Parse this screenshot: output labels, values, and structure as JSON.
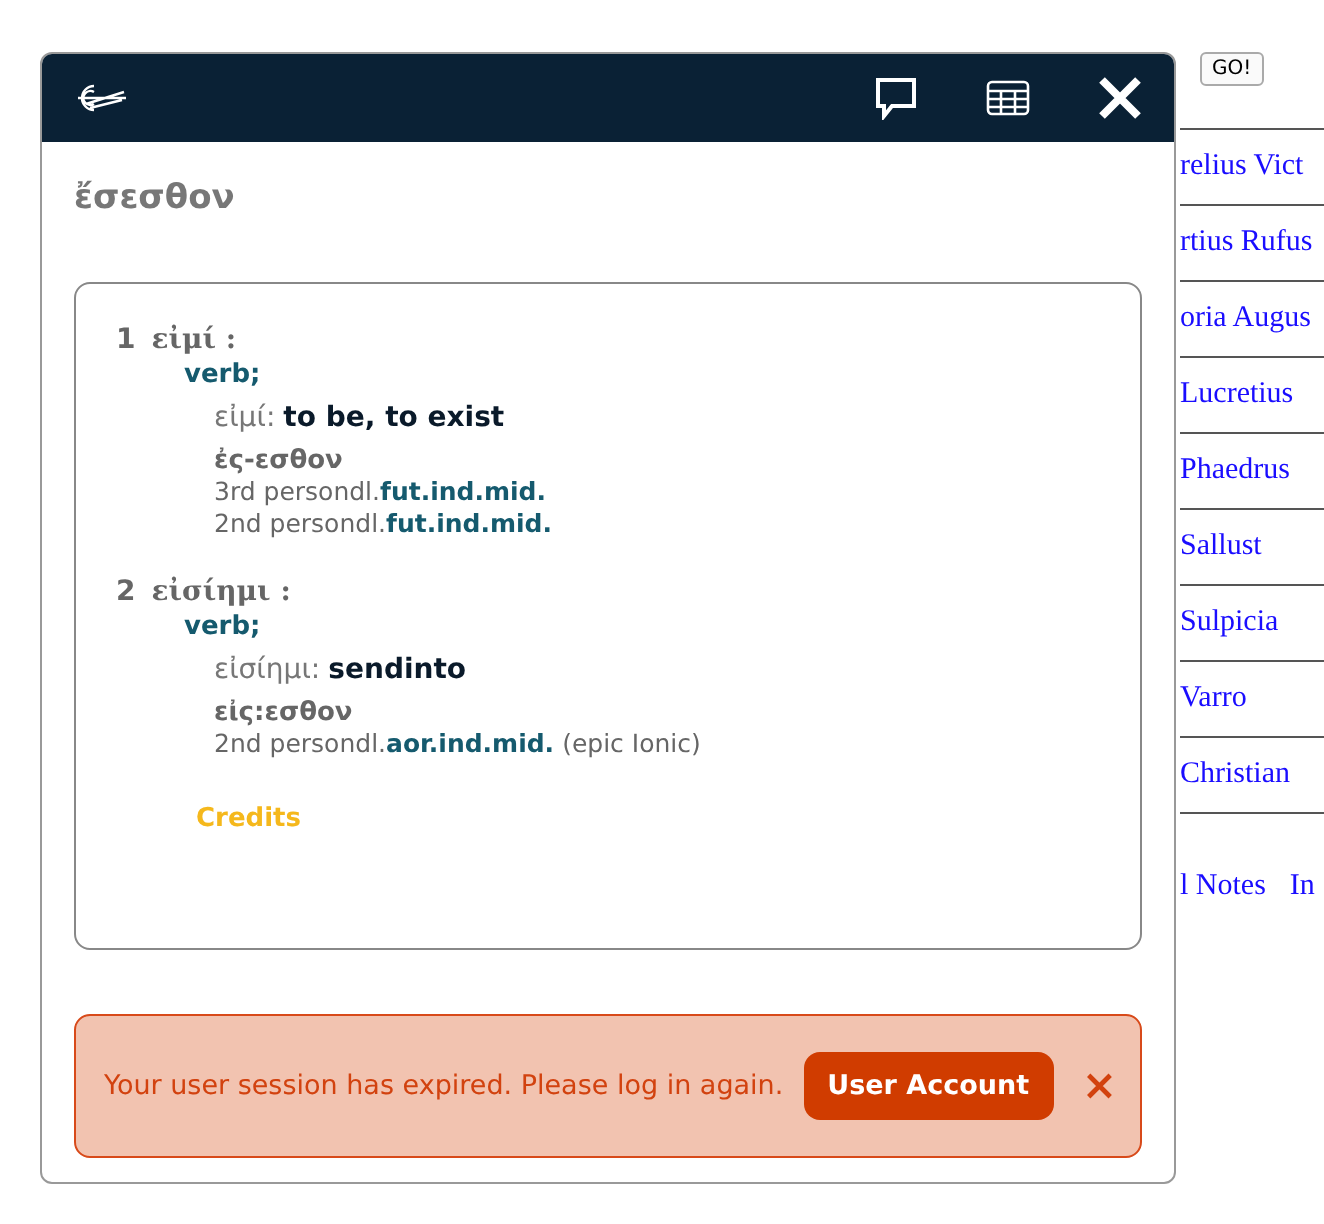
{
  "background": {
    "go_button": "GO!",
    "links": [
      "relius Vict",
      "rtius Rufus",
      "oria Augus",
      "Lucretius",
      "Phaedrus",
      "Sallust",
      "Sulpicia",
      "Varro",
      "Christian"
    ],
    "footer_links": [
      "l Notes",
      "In"
    ]
  },
  "popup": {
    "title": "ἔσεσθον",
    "entries": [
      {
        "number": "1",
        "lemma": "εἰμί :",
        "pos": "verb;",
        "gloss_word": "εἰμί:",
        "gloss": "to be, to exist",
        "form": "ἐς-εσθον",
        "parses": [
          {
            "text": "3rd persondl.",
            "tag": "fut.ind.mid."
          },
          {
            "text": "2nd persondl.",
            "tag": "fut.ind.mid."
          }
        ]
      },
      {
        "number": "2",
        "lemma": "εἰσίημι :",
        "pos": "verb;",
        "gloss_word": "εἰσίημι:",
        "gloss": "sendinto",
        "form": "εἰς:εσθον",
        "parses": [
          {
            "text": "2nd persondl.",
            "tag": "aor.ind.mid.",
            "note": "(epic Ionic)"
          }
        ]
      }
    ],
    "credits": "Credits",
    "alert": {
      "message": "Your user session has expired. Please log in again.",
      "button": "User Account"
    }
  }
}
